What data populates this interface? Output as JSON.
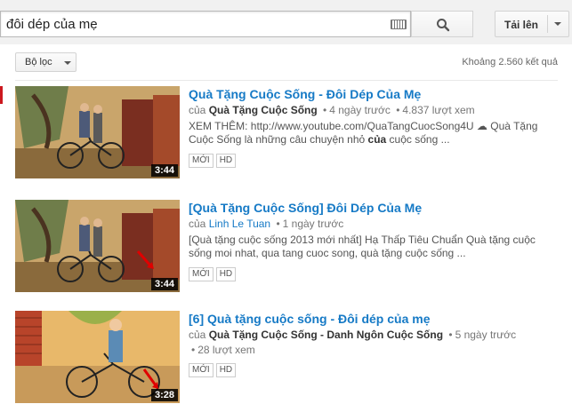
{
  "search": {
    "query": "đôi dép của mẹ"
  },
  "header": {
    "upload_label": "Tải lên"
  },
  "filter": {
    "label": "Bộ lọc",
    "result_count": "Khoảng 2.560 kết quả"
  },
  "results": [
    {
      "title": "Quà Tặng Cuộc Sống - Đôi Dép Của Mẹ",
      "by_prefix": "của",
      "channel": "Quà Tặng Cuộc Sống",
      "age": "4 ngày trước",
      "views": "4.837 lượt xem",
      "desc_line1": "XEM THÊM: http://www.youtube.com/QuaTangCuocSong4U ☁ Quà Tặng",
      "desc_line2_pre": "Cuộc Sống là những câu chuyện nhỏ ",
      "desc_line2_bold": "của",
      "desc_line2_post": " cuộc sống ...",
      "badges": [
        "MỚI",
        "HD"
      ],
      "duration": "3:44"
    },
    {
      "title": "[Quà Tặng Cuộc Sống] Đôi Dép Của Mẹ",
      "by_prefix": "của",
      "channel": "Linh Le Tuan",
      "age": "1 ngày trước",
      "desc_line1": "[Quà tặng cuộc sống 2013 mới nhất] Hạ Thấp Tiêu Chuẩn Quà tặng cuộc",
      "desc_line2": "sống moi nhat, qua tang cuoc song, quà tặng cuộc sống ...",
      "badges": [
        "MỚI",
        "HD"
      ],
      "duration": "3:44"
    },
    {
      "title": "[6] Quà tặng cuộc sống - Đôi dép của mẹ",
      "by_prefix": "của",
      "channel": "Quà Tặng Cuộc Sống - Danh Ngôn Cuộc Sống",
      "age": "5 ngày trước",
      "views": "28 lượt xem",
      "badges": [
        "MỚI",
        "HD"
      ],
      "duration": "3:28"
    }
  ]
}
